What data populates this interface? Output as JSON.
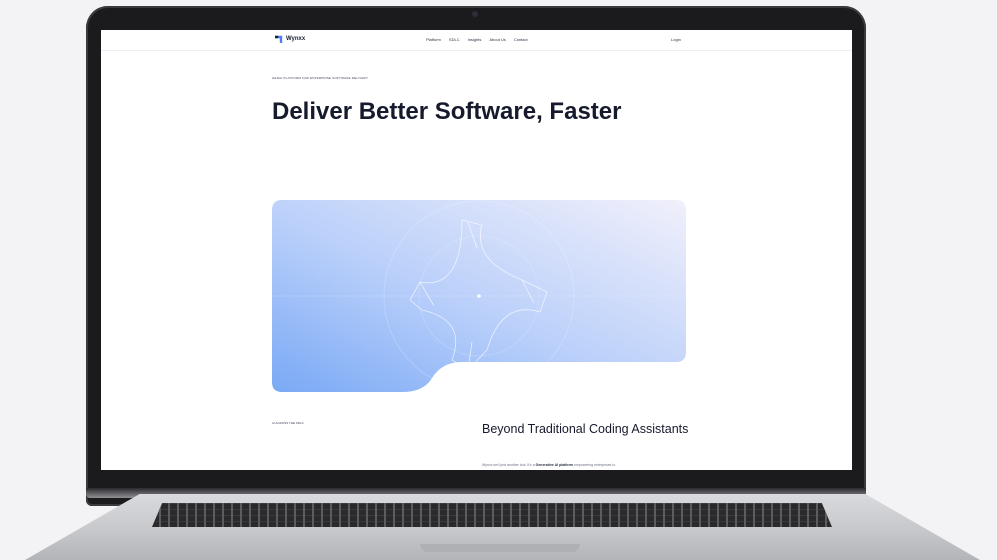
{
  "site": {
    "brand": "Wynxx",
    "nav_links": [
      "Platform",
      "SDLC",
      "Insights",
      "About Us",
      "Contact"
    ],
    "login_label": "Login",
    "eyebrow": "GenAI PLATFORM FOR ENTERPRISE SOFTWARE DELIVERY",
    "hero_title": "Deliver Better Software, Faster",
    "section_label": "AI ACROSS THE SDLC",
    "section_title": "Beyond Traditional Coding Assistants",
    "section_body_start": "Wynxx isn't just another tool. It's a ",
    "section_body_bold": "Generative AI platform",
    "section_body_end": " empowering enterprises to"
  },
  "colors": {
    "brand": "#1a2033",
    "accent_blue": "#8db6f7",
    "laptop_bezel": "#1b1b1d",
    "laptop_deck": "#c5c6ca"
  },
  "icons": {
    "logo": "wynxx-logo-icon",
    "hero_art": "four-pointed-star-icon"
  }
}
